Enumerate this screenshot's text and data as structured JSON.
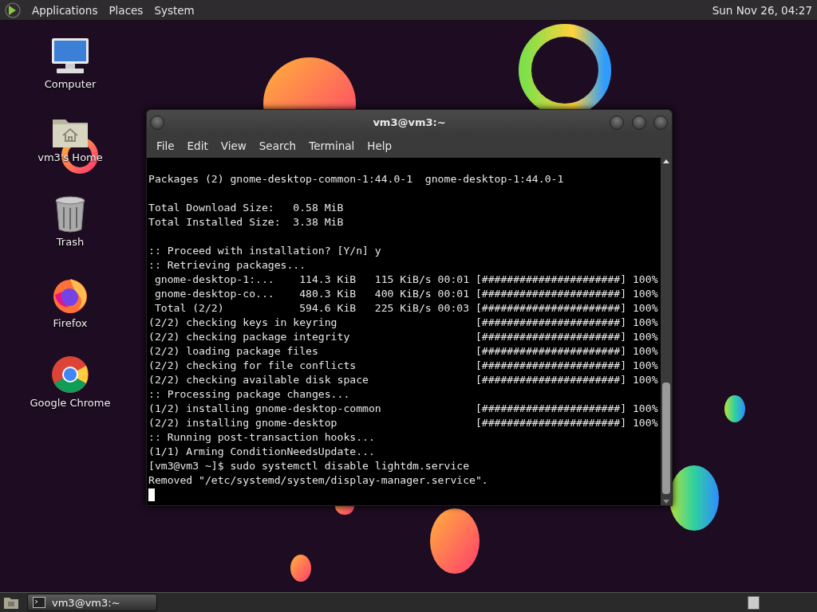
{
  "top_panel": {
    "menus": [
      "Applications",
      "Places",
      "System"
    ],
    "clock": "Sun Nov 26, 04:27"
  },
  "desktop_icons": [
    {
      "label": "Computer",
      "kind": "computer"
    },
    {
      "label": "vm3's Home",
      "kind": "home"
    },
    {
      "label": "Trash",
      "kind": "trash"
    },
    {
      "label": "Firefox",
      "kind": "firefox"
    },
    {
      "label": "Google Chrome",
      "kind": "chrome"
    }
  ],
  "terminal": {
    "title": "vm3@vm3:~",
    "menu": [
      "File",
      "Edit",
      "View",
      "Search",
      "Terminal",
      "Help"
    ],
    "blocks": [
      [
        {
          "text": "Packages (2) gnome-desktop-common-1:44.0-1  gnome-desktop-1:44.0-1"
        }
      ],
      [
        {
          "text": "Total Download Size:   0.58 MiB"
        },
        {
          "text": "Total Installed Size:  3.38 MiB"
        }
      ],
      [
        {
          "text": ":: Proceed with installation? [Y/n] y"
        },
        {
          "text": ":: Retrieving packages..."
        },
        {
          "text": " gnome-desktop-1:...    114.3 KiB   115 KiB/s 00:01",
          "bar": "[######################]",
          "percent": "100%"
        },
        {
          "text": " gnome-desktop-co...    480.3 KiB   400 KiB/s 00:01",
          "bar": "[######################]",
          "percent": "100%"
        },
        {
          "text": " Total (2/2)            594.6 KiB   225 KiB/s 00:03",
          "bar": "[######################]",
          "percent": "100%"
        },
        {
          "text": "(2/2) checking keys in keyring",
          "bar": "[######################]",
          "percent": "100%"
        },
        {
          "text": "(2/2) checking package integrity",
          "bar": "[######################]",
          "percent": "100%"
        },
        {
          "text": "(2/2) loading package files",
          "bar": "[######################]",
          "percent": "100%"
        },
        {
          "text": "(2/2) checking for file conflicts",
          "bar": "[######################]",
          "percent": "100%"
        },
        {
          "text": "(2/2) checking available disk space",
          "bar": "[######################]",
          "percent": "100%"
        },
        {
          "text": ":: Processing package changes..."
        },
        {
          "text": "(1/2) installing gnome-desktop-common",
          "bar": "[######################]",
          "percent": "100%"
        },
        {
          "text": "(2/2) installing gnome-desktop",
          "bar": "[######################]",
          "percent": "100%"
        },
        {
          "text": ":: Running post-transaction hooks..."
        },
        {
          "text": "(1/1) Arming ConditionNeedsUpdate..."
        },
        {
          "text": "[vm3@vm3 ~]$ sudo systemctl disable lightdm.service"
        },
        {
          "text": "Removed \"/etc/systemd/system/display-manager.service\"."
        }
      ]
    ]
  },
  "taskbar": {
    "tasks": [
      {
        "label": "vm3@vm3:~",
        "selected": false
      }
    ]
  }
}
